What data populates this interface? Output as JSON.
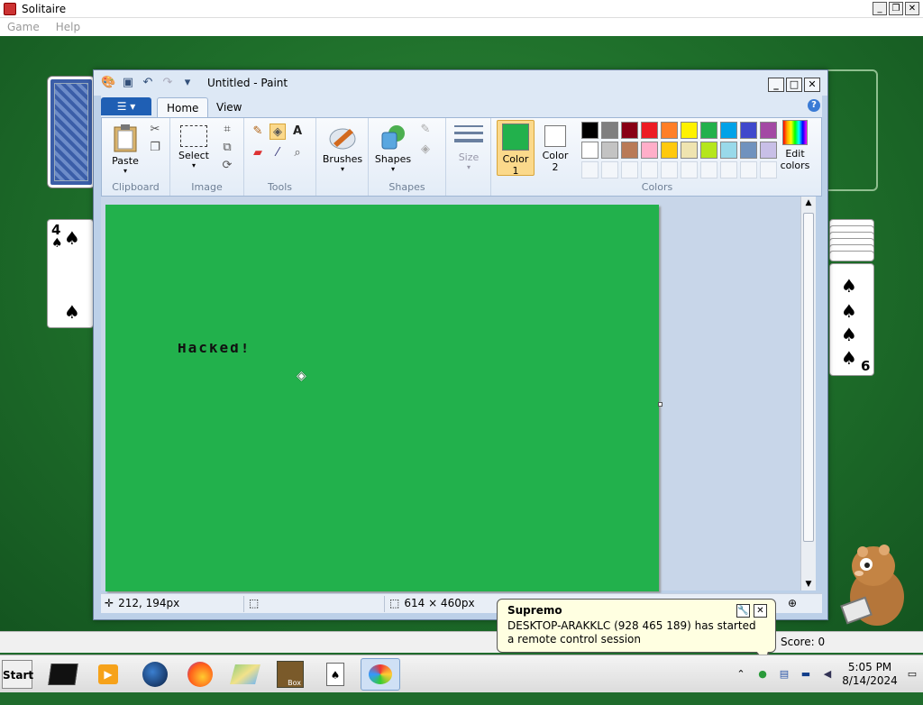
{
  "solitaire": {
    "title": "Solitaire",
    "menu": [
      "Game",
      "Help"
    ],
    "score": "Score: 0",
    "cards": {
      "left_rank": "4",
      "right_rank": "6"
    }
  },
  "paint": {
    "title": "Untitled - Paint",
    "tabs": {
      "home": "Home",
      "view": "View"
    },
    "groups": {
      "clipboard": "Clipboard",
      "image": "Image",
      "tools": "Tools",
      "shapes": "Shapes",
      "colors": "Colors"
    },
    "buttons": {
      "paste": "Paste",
      "select": "Select",
      "brushes": "Brushes",
      "shapes": "Shapes",
      "size": "Size",
      "color1": "Color 1",
      "color2": "Color 2",
      "edit_colors": "Edit colors"
    },
    "color1_value": "#22b14c",
    "color2_value": "#ffffff",
    "palette_row1": [
      "#000000",
      "#7f7f7f",
      "#880015",
      "#ed1c24",
      "#ff7f27",
      "#fff200",
      "#22b14c",
      "#00a2e8",
      "#3f48cc",
      "#a349a4"
    ],
    "palette_row2": [
      "#ffffff",
      "#c3c3c3",
      "#b97a57",
      "#ffaec9",
      "#ffc90e",
      "#efe4b0",
      "#b5e61d",
      "#99d9ea",
      "#7092be",
      "#c8bfe7"
    ],
    "canvas_text": "Hacked!",
    "status": {
      "cursor_pos": "212, 194px",
      "canvas_size": "614 × 460px"
    }
  },
  "notification": {
    "title": "Supremo",
    "message": "DESKTOP-ARAKKLC (928 465 189) has started a remote control session"
  },
  "taskbar": {
    "start": "Start",
    "time": "5:05 PM",
    "date": "8/14/2024"
  }
}
